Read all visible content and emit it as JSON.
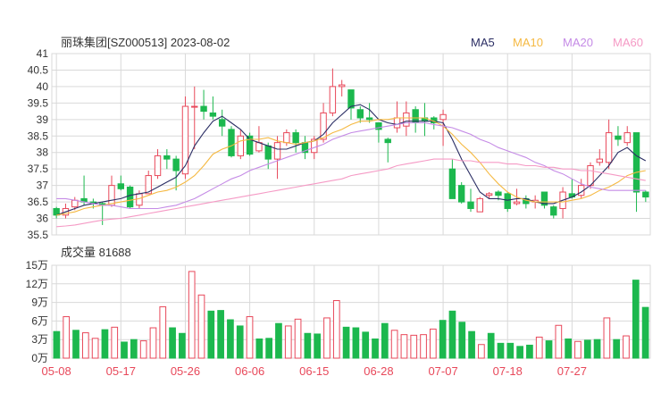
{
  "title": "丽珠集团[SZ000513] 2023-08-02",
  "legend": [
    {
      "label": "MA5",
      "color": "#2b2e64"
    },
    {
      "label": "MA10",
      "color": "#f5b942"
    },
    {
      "label": "MA20",
      "color": "#c58be6"
    },
    {
      "label": "MA60",
      "color": "#f59ac5"
    }
  ],
  "colors": {
    "up": "#e8485a",
    "down": "#1cb84e",
    "grid": "#d9d9d9",
    "axis_text": "#333333",
    "date_text": "#e8485a"
  },
  "volume_title": "成交量 81688",
  "chart_data": [
    {
      "type": "candlestick",
      "name": "price",
      "ylim": [
        35.5,
        41
      ],
      "yticks": [
        "41",
        "40.5",
        "40",
        "39.5",
        "39",
        "38.5",
        "38",
        "37.5",
        "37",
        "36.5",
        "36",
        "35.5"
      ],
      "ytick_values": [
        41,
        40.5,
        40,
        39.5,
        39,
        38.5,
        38,
        37.5,
        37,
        36.5,
        36,
        35.5
      ],
      "x_labels": [
        {
          "index": 0,
          "label": "05-08"
        },
        {
          "index": 7,
          "label": "05-17"
        },
        {
          "index": 14,
          "label": "05-26"
        },
        {
          "index": 21,
          "label": "06-06"
        },
        {
          "index": 28,
          "label": "06-15"
        },
        {
          "index": 35,
          "label": "06-28"
        },
        {
          "index": 42,
          "label": "07-07"
        },
        {
          "index": 49,
          "label": "07-18"
        },
        {
          "index": 56,
          "label": "07-27"
        }
      ],
      "candles": [
        [
          36.3,
          36.1,
          36.35,
          36.0
        ],
        [
          36.1,
          36.3,
          36.45,
          36.0
        ],
        [
          36.35,
          36.55,
          36.65,
          36.25
        ],
        [
          36.6,
          36.5,
          37.3,
          36.4
        ],
        [
          36.5,
          36.45,
          36.6,
          36.3
        ],
        [
          36.45,
          36.4,
          36.5,
          35.8
        ],
        [
          36.4,
          37.0,
          37.3,
          36.35
        ],
        [
          37.05,
          36.9,
          37.3,
          36.85
        ],
        [
          36.95,
          36.35,
          37.0,
          36.3
        ],
        [
          36.4,
          36.75,
          36.85,
          36.3
        ],
        [
          36.75,
          37.3,
          37.45,
          36.75
        ],
        [
          37.3,
          37.9,
          38.1,
          37.2
        ],
        [
          37.9,
          37.8,
          38.1,
          37.5
        ],
        [
          37.8,
          37.45,
          37.9,
          36.85
        ],
        [
          37.35,
          39.4,
          39.7,
          37.2
        ],
        [
          39.4,
          39.4,
          40.0,
          38.1
        ],
        [
          39.4,
          39.25,
          39.9,
          39.0
        ],
        [
          39.2,
          39.1,
          39.7,
          39.0
        ],
        [
          39.0,
          38.8,
          39.3,
          38.5
        ],
        [
          38.7,
          37.9,
          38.8,
          37.85
        ],
        [
          37.9,
          38.5,
          38.7,
          37.8
        ],
        [
          38.5,
          37.95,
          38.6,
          37.9
        ],
        [
          38.05,
          38.3,
          38.8,
          38.0
        ],
        [
          38.2,
          37.8,
          38.3,
          37.5
        ],
        [
          37.8,
          38.3,
          38.5,
          37.2
        ],
        [
          38.3,
          38.6,
          38.7,
          38.2
        ],
        [
          38.6,
          38.3,
          38.7,
          38.0
        ],
        [
          38.3,
          38.0,
          38.5,
          37.8
        ],
        [
          38.0,
          38.4,
          38.5,
          37.8
        ],
        [
          38.4,
          39.2,
          39.5,
          38.3
        ],
        [
          39.2,
          40.0,
          40.55,
          39.1
        ],
        [
          40.0,
          40.05,
          40.2,
          39.7
        ],
        [
          39.9,
          39.35,
          39.9,
          39.0
        ],
        [
          39.3,
          39.05,
          39.4,
          38.9
        ],
        [
          39.05,
          39.0,
          39.5,
          38.9
        ],
        [
          38.9,
          38.7,
          38.9,
          38.3
        ],
        [
          38.4,
          38.3,
          38.45,
          37.7
        ],
        [
          38.75,
          39.05,
          39.55,
          38.6
        ],
        [
          38.8,
          39.2,
          39.55,
          38.5
        ],
        [
          39.3,
          38.9,
          39.4,
          38.6
        ],
        [
          39.05,
          38.95,
          39.5,
          38.5
        ],
        [
          39.05,
          38.9,
          39.1,
          38.7
        ],
        [
          39.0,
          39.15,
          39.3,
          38.2
        ],
        [
          37.5,
          36.6,
          37.8,
          36.6
        ],
        [
          37.0,
          36.5,
          37.1,
          36.45
        ],
        [
          36.5,
          36.3,
          36.9,
          36.2
        ],
        [
          36.2,
          36.6,
          36.65,
          36.2
        ],
        [
          36.7,
          36.75,
          36.8,
          36.6
        ],
        [
          36.8,
          36.7,
          36.85,
          36.55
        ],
        [
          36.75,
          36.3,
          36.8,
          36.2
        ],
        [
          36.45,
          36.5,
          36.9,
          36.4
        ],
        [
          36.6,
          36.45,
          36.7,
          36.3
        ],
        [
          36.5,
          36.55,
          36.7,
          36.3
        ],
        [
          36.8,
          36.4,
          36.8,
          36.3
        ],
        [
          36.35,
          36.1,
          36.4,
          36.0
        ],
        [
          36.3,
          36.8,
          36.95,
          36.0
        ],
        [
          36.75,
          36.65,
          37.2,
          36.6
        ],
        [
          36.7,
          37.0,
          37.2,
          36.6
        ],
        [
          37.0,
          37.6,
          37.7,
          36.9
        ],
        [
          37.7,
          37.8,
          38.1,
          37.6
        ],
        [
          37.7,
          38.6,
          39.0,
          37.5
        ],
        [
          38.5,
          38.4,
          38.8,
          38.2
        ],
        [
          38.3,
          38.6,
          38.8,
          38.2
        ],
        [
          38.6,
          36.8,
          38.6,
          36.2
        ],
        [
          36.8,
          36.65,
          36.85,
          36.5
        ]
      ],
      "ma": {
        "MA5": [
          36.1,
          36.2,
          36.3,
          36.4,
          36.45,
          36.5,
          36.55,
          36.6,
          36.7,
          36.75,
          36.8,
          36.95,
          37.1,
          37.25,
          37.6,
          38.2,
          38.6,
          38.95,
          39.1,
          38.9,
          38.7,
          38.4,
          38.3,
          38.2,
          38.1,
          38.1,
          38.2,
          38.3,
          38.35,
          38.55,
          38.9,
          39.15,
          39.4,
          39.45,
          39.3,
          39.0,
          38.9,
          38.85,
          38.95,
          38.95,
          38.95,
          38.95,
          38.9,
          38.4,
          37.8,
          37.3,
          36.8,
          36.6,
          36.6,
          36.55,
          36.6,
          36.6,
          36.5,
          36.45,
          36.45,
          36.55,
          36.65,
          36.8,
          37.0,
          37.3,
          37.6,
          38.0,
          38.15,
          37.9,
          37.75
        ],
        "MA10": [
          36.1,
          36.15,
          36.2,
          36.3,
          36.35,
          36.4,
          36.45,
          36.5,
          36.55,
          36.6,
          36.7,
          36.8,
          36.85,
          36.95,
          37.1,
          37.3,
          37.6,
          37.95,
          38.1,
          38.2,
          38.35,
          38.4,
          38.4,
          38.45,
          38.35,
          38.3,
          38.25,
          38.3,
          38.35,
          38.45,
          38.6,
          38.7,
          38.85,
          38.95,
          38.95,
          39.0,
          39.0,
          39.05,
          39.05,
          39.05,
          39.05,
          38.95,
          38.8,
          38.55,
          38.25,
          38.0,
          37.7,
          37.35,
          37.05,
          36.8,
          36.65,
          36.55,
          36.5,
          36.5,
          36.5,
          36.5,
          36.55,
          36.6,
          36.7,
          36.85,
          36.95,
          37.1,
          37.3,
          37.4,
          37.45
        ],
        "MA20": [
          36.6,
          36.6,
          36.55,
          36.5,
          36.45,
          36.4,
          36.4,
          36.35,
          36.3,
          36.3,
          36.3,
          36.3,
          36.35,
          36.4,
          36.5,
          36.6,
          36.75,
          36.9,
          37.05,
          37.2,
          37.3,
          37.45,
          37.55,
          37.65,
          37.75,
          37.85,
          37.95,
          38.05,
          38.15,
          38.25,
          38.4,
          38.5,
          38.6,
          38.65,
          38.7,
          38.75,
          38.8,
          38.85,
          38.9,
          38.9,
          38.9,
          38.85,
          38.8,
          38.75,
          38.65,
          38.55,
          38.4,
          38.3,
          38.15,
          38.05,
          37.95,
          37.85,
          37.7,
          37.6,
          37.45,
          37.35,
          37.2,
          37.05,
          36.95,
          36.9,
          36.85,
          36.85,
          36.85,
          36.85,
          36.85
        ],
        "MA60": [
          35.75,
          35.77,
          35.8,
          35.85,
          35.9,
          35.95,
          35.98,
          36.0,
          36.05,
          36.1,
          36.15,
          36.2,
          36.25,
          36.3,
          36.35,
          36.4,
          36.45,
          36.5,
          36.55,
          36.6,
          36.65,
          36.7,
          36.75,
          36.8,
          36.85,
          36.9,
          36.95,
          37.0,
          37.05,
          37.1,
          37.15,
          37.2,
          37.3,
          37.35,
          37.4,
          37.45,
          37.5,
          37.6,
          37.65,
          37.7,
          37.75,
          37.8,
          37.8,
          37.8,
          37.75,
          37.75,
          37.7,
          37.7,
          37.7,
          37.65,
          37.65,
          37.6,
          37.6,
          37.55,
          37.55,
          37.5,
          37.5,
          37.45,
          37.45,
          37.4,
          37.35,
          37.3,
          37.25,
          37.2,
          37.15
        ]
      }
    },
    {
      "type": "bar",
      "name": "volume",
      "ylim": [
        0,
        15
      ],
      "yticks": [
        "15万",
        "12万",
        "9万",
        "6万",
        "3万",
        "0万"
      ],
      "ytick_values": [
        15,
        12,
        9,
        6,
        3,
        0
      ],
      "values": [
        4.3,
        6.7,
        4.5,
        4.1,
        3.2,
        4.6,
        5.0,
        2.6,
        3.0,
        2.8,
        4.9,
        8.3,
        4.9,
        4.0,
        14.0,
        10.2,
        7.6,
        7.7,
        6.2,
        5.2,
        6.7,
        3.1,
        3.2,
        5.6,
        5.2,
        6.3,
        4.0,
        3.9,
        6.5,
        9.3,
        5.0,
        4.9,
        4.2,
        3.1,
        5.6,
        4.5,
        3.8,
        3.7,
        3.8,
        4.7,
        6.1,
        7.6,
        5.8,
        4.3,
        2.2,
        4.0,
        2.4,
        2.4,
        1.9,
        2.1,
        3.4,
        2.8,
        5.3,
        3.1,
        2.7,
        2.9,
        3.0,
        6.5,
        3.0,
        3.6,
        12.6,
        8.2
      ],
      "up": [
        0,
        1,
        0,
        1,
        1,
        0,
        1,
        0,
        0,
        1,
        1,
        1,
        0,
        0,
        1,
        1,
        0,
        0,
        0,
        0,
        1,
        0,
        0,
        0,
        1,
        1,
        0,
        0,
        1,
        1,
        0,
        0,
        0,
        0,
        0,
        1,
        1,
        1,
        1,
        1,
        0,
        0,
        0,
        0,
        1,
        0,
        0,
        0,
        0,
        0,
        1,
        0,
        1,
        0,
        1,
        0,
        0,
        1,
        0,
        1,
        0,
        0
      ]
    }
  ]
}
